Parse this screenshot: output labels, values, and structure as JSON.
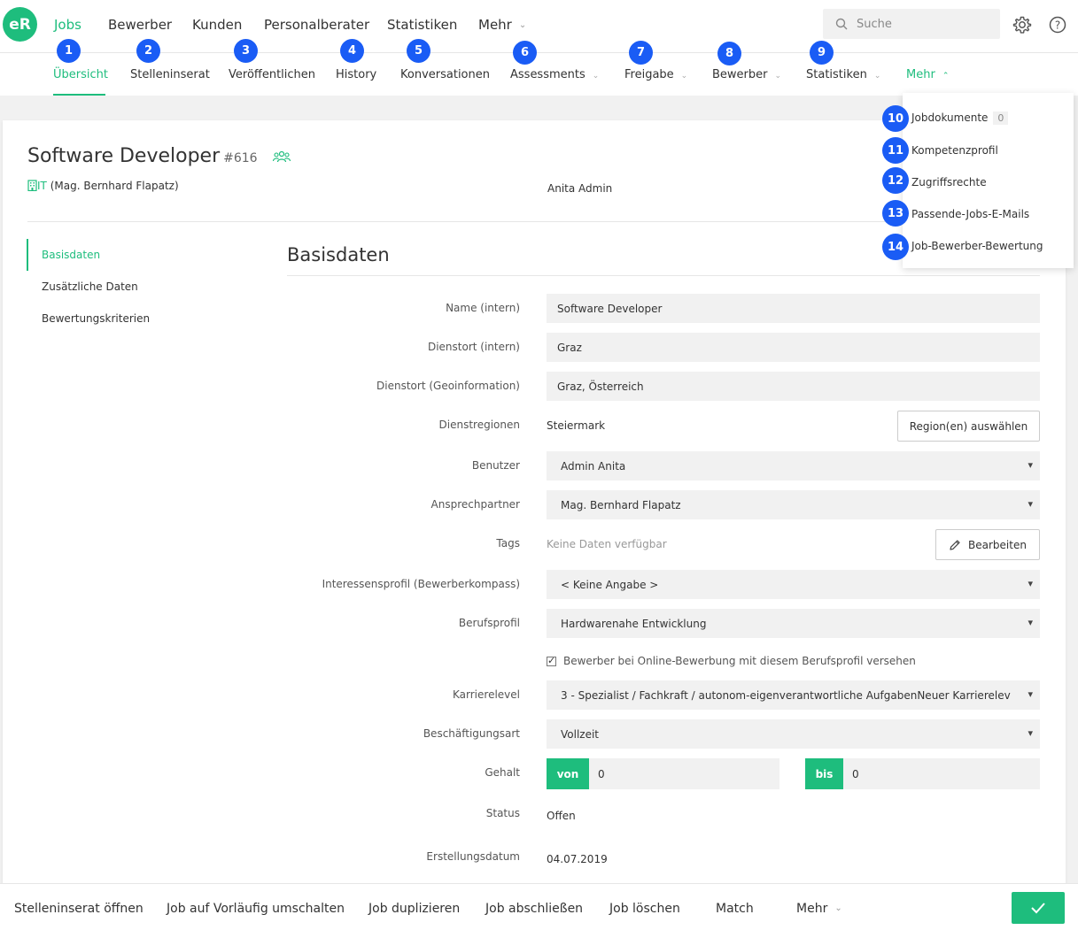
{
  "logo": "eR",
  "topnav": {
    "items": [
      "Jobs",
      "Bewerber",
      "Kunden",
      "Personalberater",
      "Statistiken",
      "Mehr"
    ],
    "active": "Jobs"
  },
  "search": {
    "placeholder": "Suche"
  },
  "subnav": {
    "items": [
      "Übersicht",
      "Stelleninserat",
      "Veröffentlichen",
      "History",
      "Konversationen",
      "Assessments",
      "Freigabe",
      "Bewerber",
      "Statistiken",
      "Mehr"
    ],
    "active": "Übersicht"
  },
  "badges": [
    "1",
    "2",
    "3",
    "4",
    "5",
    "6",
    "7",
    "8",
    "9",
    "10",
    "11",
    "12",
    "13",
    "14"
  ],
  "more_menu": {
    "items": [
      "Jobdokumente",
      "Kompetenzprofil",
      "Zugriffsrechte",
      "Passende-Jobs-E-Mails",
      "Job-Bewerber-Bewertung"
    ],
    "doc_count": "0"
  },
  "job": {
    "title": "Software Developer",
    "number": "#616",
    "dept": "IT",
    "dept_contact": "(Mag. Bernhard Flapatz)",
    "owner": "Anita Admin"
  },
  "sidenav": [
    "Basisdaten",
    "Zusätzliche Daten",
    "Bewertungskriterien"
  ],
  "section_title": "Basisdaten",
  "form": {
    "name_label": "Name (intern)",
    "name_value": "Software Developer",
    "site_label": "Dienstort (intern)",
    "site_value": "Graz",
    "geo_label": "Dienstort (Geoinformation)",
    "geo_value": "Graz, Österreich",
    "regions_label": "Dienstregionen",
    "regions_value": "Steiermark",
    "regions_button": "Region(en) auswählen",
    "user_label": "Benutzer",
    "user_value": "Admin Anita",
    "contact_label": "Ansprechpartner",
    "contact_value": "Mag. Bernhard Flapatz",
    "tags_label": "Tags",
    "tags_value": "Keine Daten verfügbar",
    "tags_button": "Bearbeiten",
    "interest_label": "Interessensprofil (Bewerberkompass)",
    "interest_value": "< Keine Angabe >",
    "profession_label": "Berufsprofil",
    "profession_value": "Hardwarenahe Entwicklung",
    "checkbox_label": "Bewerber bei Online-Bewerbung mit diesem Berufsprofil versehen",
    "career_label": "Karrierelevel",
    "career_value": "3 - Spezialist / Fachkraft / autonom-eigenverantwortliche AufgabenNeuer Karrierelev",
    "employment_label": "Beschäftigungsart",
    "employment_value": "Vollzeit",
    "salary_label": "Gehalt",
    "salary_from_label": "von",
    "salary_from": "0",
    "salary_to_label": "bis",
    "salary_to": "0",
    "status_label": "Status",
    "status_value": "Offen",
    "created_label": "Erstellungsdatum",
    "created_value": "04.07.2019"
  },
  "footer": [
    "Stelleninserat öffnen",
    "Job auf Vorläufig umschalten",
    "Job duplizieren",
    "Job abschließen",
    "Job löschen",
    "Match",
    "Mehr"
  ],
  "colors": {
    "accent": "#1ebd7d",
    "badge": "#1a5cf5"
  }
}
